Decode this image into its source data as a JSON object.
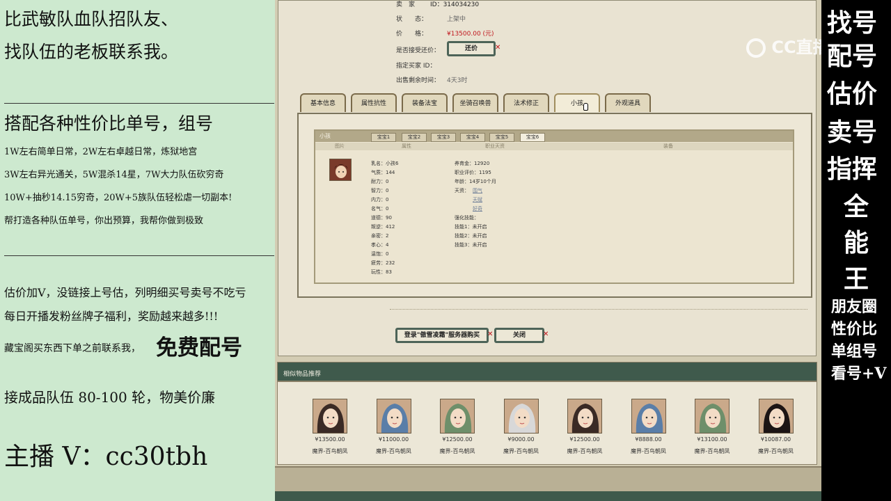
{
  "left_ad": {
    "line1": "比武敏队血队招队友、",
    "line2": "找队伍的老板联系我。",
    "line3": "搭配各种性价比单号，组号",
    "line4": "1W左右简单日常，2W左右卓越日常，炼狱地宫",
    "line5": "3W左右异光通关，5W混杀14星，7W大力队伍砍穷奇",
    "line6": "10W+抽秒14.15穷奇，20W+5族队伍轻松虐一切副本!",
    "line7": "帮打造各种队伍单号，你出预算，我帮你做到极致",
    "line8": "估价加V，没链接上号估，列明细买号卖号不吃亏",
    "line9": "每日开播发粉丝牌子福利，奖励越来越多!!!",
    "line10a": "藏宝阁买东西下单之前联系我，",
    "line10b": "免费配号",
    "line11": "接成品队伍 80-100 轮，物美价廉",
    "line12": "主播 V：cc30tbh"
  },
  "seller": {
    "seller_label": "卖　家",
    "seller_value": "ID：314034230",
    "status_label": "状　　态：",
    "status_value": "上架中",
    "price_label": "价　　格：",
    "price_value": "¥13500.00 (元)",
    "bargain_label": "是否接受还价：",
    "bargain_button": "还价",
    "buyer_label": "指定买家 ID：",
    "time_label": "出售剩余时间：",
    "time_value": "4天3时"
  },
  "tabs": [
    "基本信息",
    "属性抗性",
    "装备法宝",
    "坐骑召唤兽",
    "法术修正",
    "小孩",
    "外观道具"
  ],
  "child": {
    "title": "小孩",
    "subtabs": [
      "宝宝1",
      "宝宝2",
      "宝宝3",
      "宝宝4",
      "宝宝5",
      "宝宝6"
    ],
    "columns": [
      "图片",
      "属性",
      "职业天资",
      "装备"
    ],
    "stats": [
      {
        "k": "乳名：",
        "v": "小孩6"
      },
      {
        "k": "气质：",
        "v": "144"
      },
      {
        "k": "耐力：",
        "v": "0"
      },
      {
        "k": "智力：",
        "v": "0"
      },
      {
        "k": "内力：",
        "v": "0"
      },
      {
        "k": "名气：",
        "v": "0"
      },
      {
        "k": "道德：",
        "v": "90"
      },
      {
        "k": "叛逆：",
        "v": "412"
      },
      {
        "k": "亲密：",
        "v": "2"
      },
      {
        "k": "孝心：",
        "v": "4"
      },
      {
        "k": "温饱：",
        "v": "0"
      },
      {
        "k": "疲劳：",
        "v": "232"
      },
      {
        "k": "玩性：",
        "v": "83"
      }
    ],
    "career": {
      "fee_label": "养育金：",
      "fee": "12920",
      "score_label": "职业评价：",
      "score": "1195",
      "age_label": "年龄：",
      "age": "14岁10个月",
      "talent_label": "天资：",
      "talents": [
        "围气",
        "天赋",
        "好奇"
      ],
      "skill_label": "强化技能：",
      "skill1": "技能1：未开启",
      "skill2": "技能2：未开启",
      "skill3": "技能3：未开启"
    }
  },
  "actions": {
    "login_button": "登录\"傲雪凌霜\"服务器购买",
    "close_button": "关闭"
  },
  "similar": {
    "header": "相似物品推荐",
    "items": [
      {
        "price": "¥13500.00",
        "server": "魔界-百鸟朝凤"
      },
      {
        "price": "¥11000.00",
        "server": "魔界-百鸟朝凤"
      },
      {
        "price": "¥12500.00",
        "server": "魔界-百鸟朝凤"
      },
      {
        "price": "¥9000.00",
        "server": "魔界-百鸟朝凤"
      },
      {
        "price": "¥12500.00",
        "server": "魔界-百鸟朝凤"
      },
      {
        "price": "¥8888.00",
        "server": "魔界-百鸟朝凤"
      },
      {
        "price": "¥13100.00",
        "server": "魔界-百鸟朝凤"
      },
      {
        "price": "¥10087.00",
        "server": "魔界-百鸟朝凤"
      }
    ]
  },
  "watermark": "CC直播",
  "right_ad": {
    "big": [
      "找号",
      "配号",
      "估价",
      "卖号",
      "指挥",
      "全",
      "能",
      "王"
    ],
    "small": [
      "朋友圈",
      "性价比",
      "单组号",
      "看号+V"
    ]
  },
  "colors": {
    "left_bg": "#cde9cf",
    "price_red": "#c0141b",
    "frame_green": "#4d6458"
  }
}
